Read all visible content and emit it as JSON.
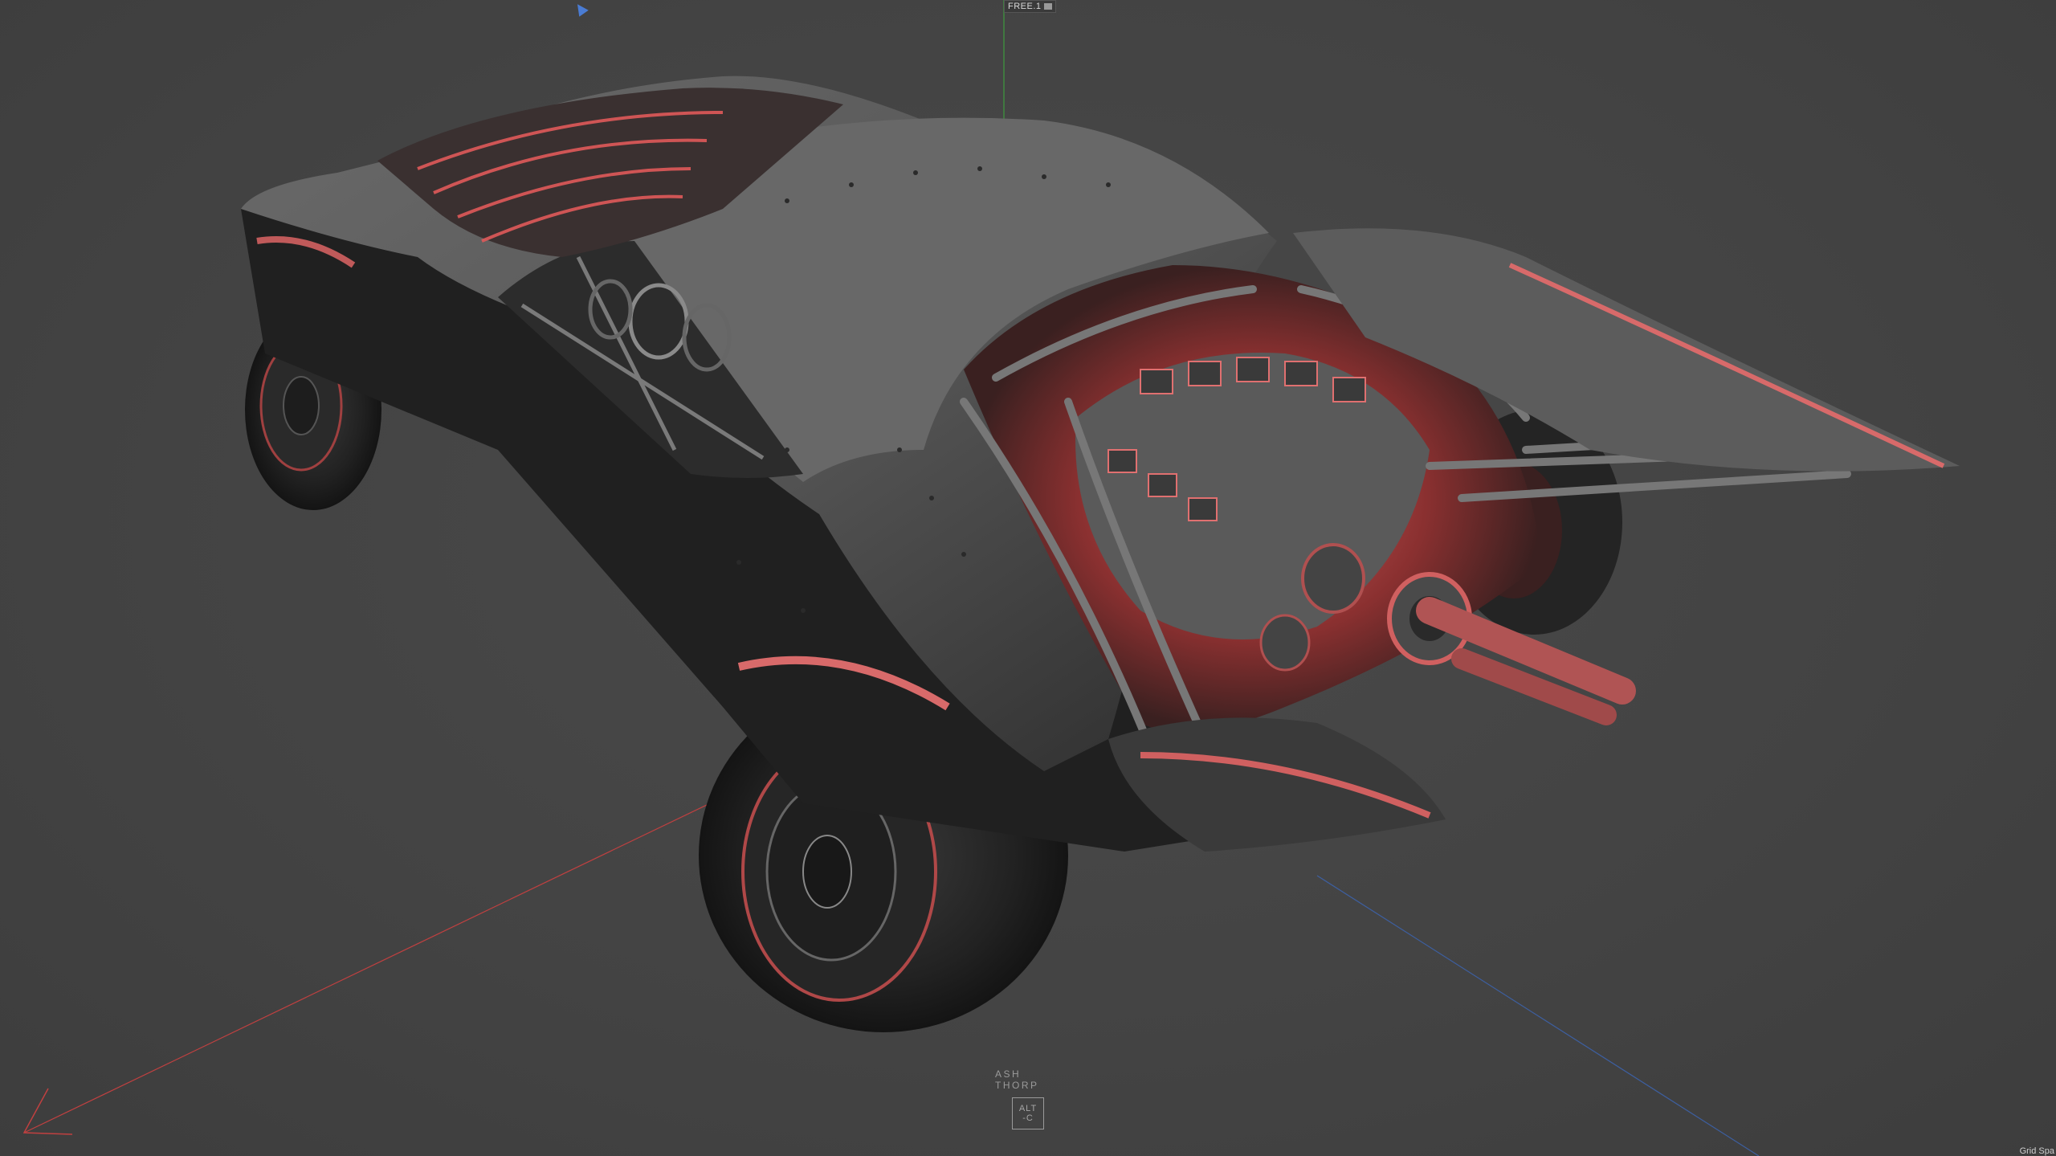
{
  "viewport": {
    "camera_label": "FREE.1",
    "grid_label": "Grid Spa"
  },
  "watermark": {
    "name": "ASH THORP",
    "logo_line1": "ALT",
    "logo_line2": "-C"
  },
  "icons": [
    "camera-icon",
    "view-cursor-icon",
    "car-model-render",
    "world-axis-gizmo"
  ],
  "colors": {
    "background": "#454545",
    "body": "#5c5c5c",
    "highlight_red": "#e84a4a",
    "axis_x": "#c04040",
    "axis_y": "#3f8a3f",
    "axis_z": "#3d5fa0"
  }
}
